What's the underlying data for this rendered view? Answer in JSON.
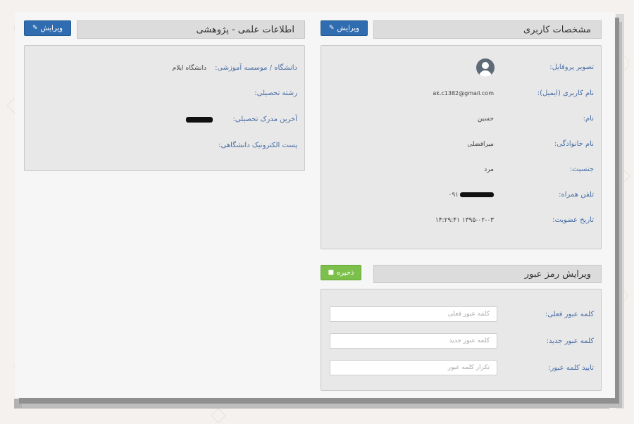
{
  "left_panel": {
    "title": "اطلاعات علمی - پژوهشی",
    "edit_button": "ویرایش",
    "fields": [
      {
        "label": "دانشگاه / موسسه آموزشی:",
        "value": "دانشگاه ایلام"
      },
      {
        "label": "رشته تحصیلی:",
        "value": ""
      },
      {
        "label": "آخرین مدرک تحصیلی:",
        "value": ""
      },
      {
        "label": "پست الکترونیک دانشگاهی:",
        "value": ""
      }
    ]
  },
  "right_panel": {
    "title": "مشخصات کاربری",
    "edit_button": "ویرایش",
    "fields": [
      {
        "label": "تصویر پروفایل:",
        "value": ""
      },
      {
        "label": "نام کاربری (ایمیل):",
        "value": "ak.c1382@gmail.com"
      },
      {
        "label": "نام:",
        "value": "حسین"
      },
      {
        "label": "نام خانوادگی:",
        "value": "میرافضلی"
      },
      {
        "label": "جنسیت:",
        "value": "مرد"
      },
      {
        "label": "تلفن همراه:",
        "value": "۰۹۱"
      },
      {
        "label": "تاریخ عضویت:",
        "value": "۱۳۹۵-۰۲-۰۳ ۱۴:۲۹:۴۱"
      }
    ]
  },
  "password_panel": {
    "title": "ویرایش رمز عبور",
    "save_button": "ذخیره",
    "fields": [
      {
        "label": "کلمه عبور فعلی:",
        "placeholder": "کلمه عبور فعلی"
      },
      {
        "label": "کلمه عبور جدید:",
        "placeholder": "کلمه عبور جدید"
      },
      {
        "label": "تایید کلمه عبور:",
        "placeholder": "تکرار کلمه عبور"
      }
    ]
  },
  "colors": {
    "primary_button": "#2f6db0",
    "success_button": "#7cc04b",
    "label_text": "#4a6fa6",
    "panel_header": "#dcdcdc"
  },
  "icons": {
    "edit": "edit-icon",
    "save": "save-icon",
    "avatar": "user-avatar-icon"
  }
}
